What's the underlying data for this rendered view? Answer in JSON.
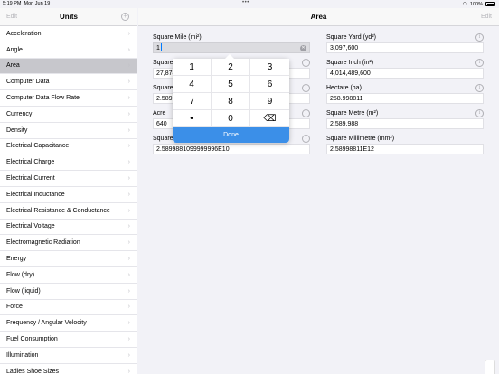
{
  "status": {
    "time": "5:19 PM",
    "date": "Mon Jun 19",
    "dots": "•••",
    "battery_pct": "100%"
  },
  "sidebar": {
    "edit_label": "Edit",
    "title": "Units",
    "add_symbol": "+",
    "items": [
      {
        "label": "Acceleration"
      },
      {
        "label": "Angle"
      },
      {
        "label": "Area"
      },
      {
        "label": "Computer Data"
      },
      {
        "label": "Computer Data Flow Rate"
      },
      {
        "label": "Currency"
      },
      {
        "label": "Density"
      },
      {
        "label": "Electrical Capacitance"
      },
      {
        "label": "Electrical Charge"
      },
      {
        "label": "Electrical Current"
      },
      {
        "label": "Electrical Inductance"
      },
      {
        "label": "Electrical Resistance & Conductance"
      },
      {
        "label": "Electrical Voltage"
      },
      {
        "label": "Electromagnetic Radiation"
      },
      {
        "label": "Energy"
      },
      {
        "label": "Flow (dry)"
      },
      {
        "label": "Flow (liquid)"
      },
      {
        "label": "Force"
      },
      {
        "label": "Frequency / Angular Velocity"
      },
      {
        "label": "Fuel Consumption"
      },
      {
        "label": "Illumination"
      },
      {
        "label": "Ladies Shoe Sizes"
      }
    ],
    "selected": "Area"
  },
  "main": {
    "title": "Area",
    "edit_label": "Edit",
    "left_fields": [
      {
        "label": "Square Mile (mi²)",
        "value": "1"
      },
      {
        "label": "Square",
        "value": "27,878"
      },
      {
        "label": "Square",
        "value": "2.589"
      },
      {
        "label": "Acre",
        "value": "640"
      },
      {
        "label": "Square",
        "value": "2.5899881099999996E10"
      }
    ],
    "right_fields": [
      {
        "label": "Square Yard (yd²)",
        "value": "3,097,600"
      },
      {
        "label": "Square Inch (in²)",
        "value": "4,014,489,600"
      },
      {
        "label": "Hectare (ha)",
        "value": "258.998811"
      },
      {
        "label": "Square Metre (m²)",
        "value": "2,589,988"
      },
      {
        "label": "Square Millimetre (mm²)",
        "value": "2.58998811E12"
      }
    ]
  },
  "keypad": {
    "keys": [
      "1",
      "2",
      "3",
      "4",
      "5",
      "6",
      "7",
      "8",
      "9",
      "•",
      "0",
      "⌫"
    ],
    "done_label": "Done"
  }
}
